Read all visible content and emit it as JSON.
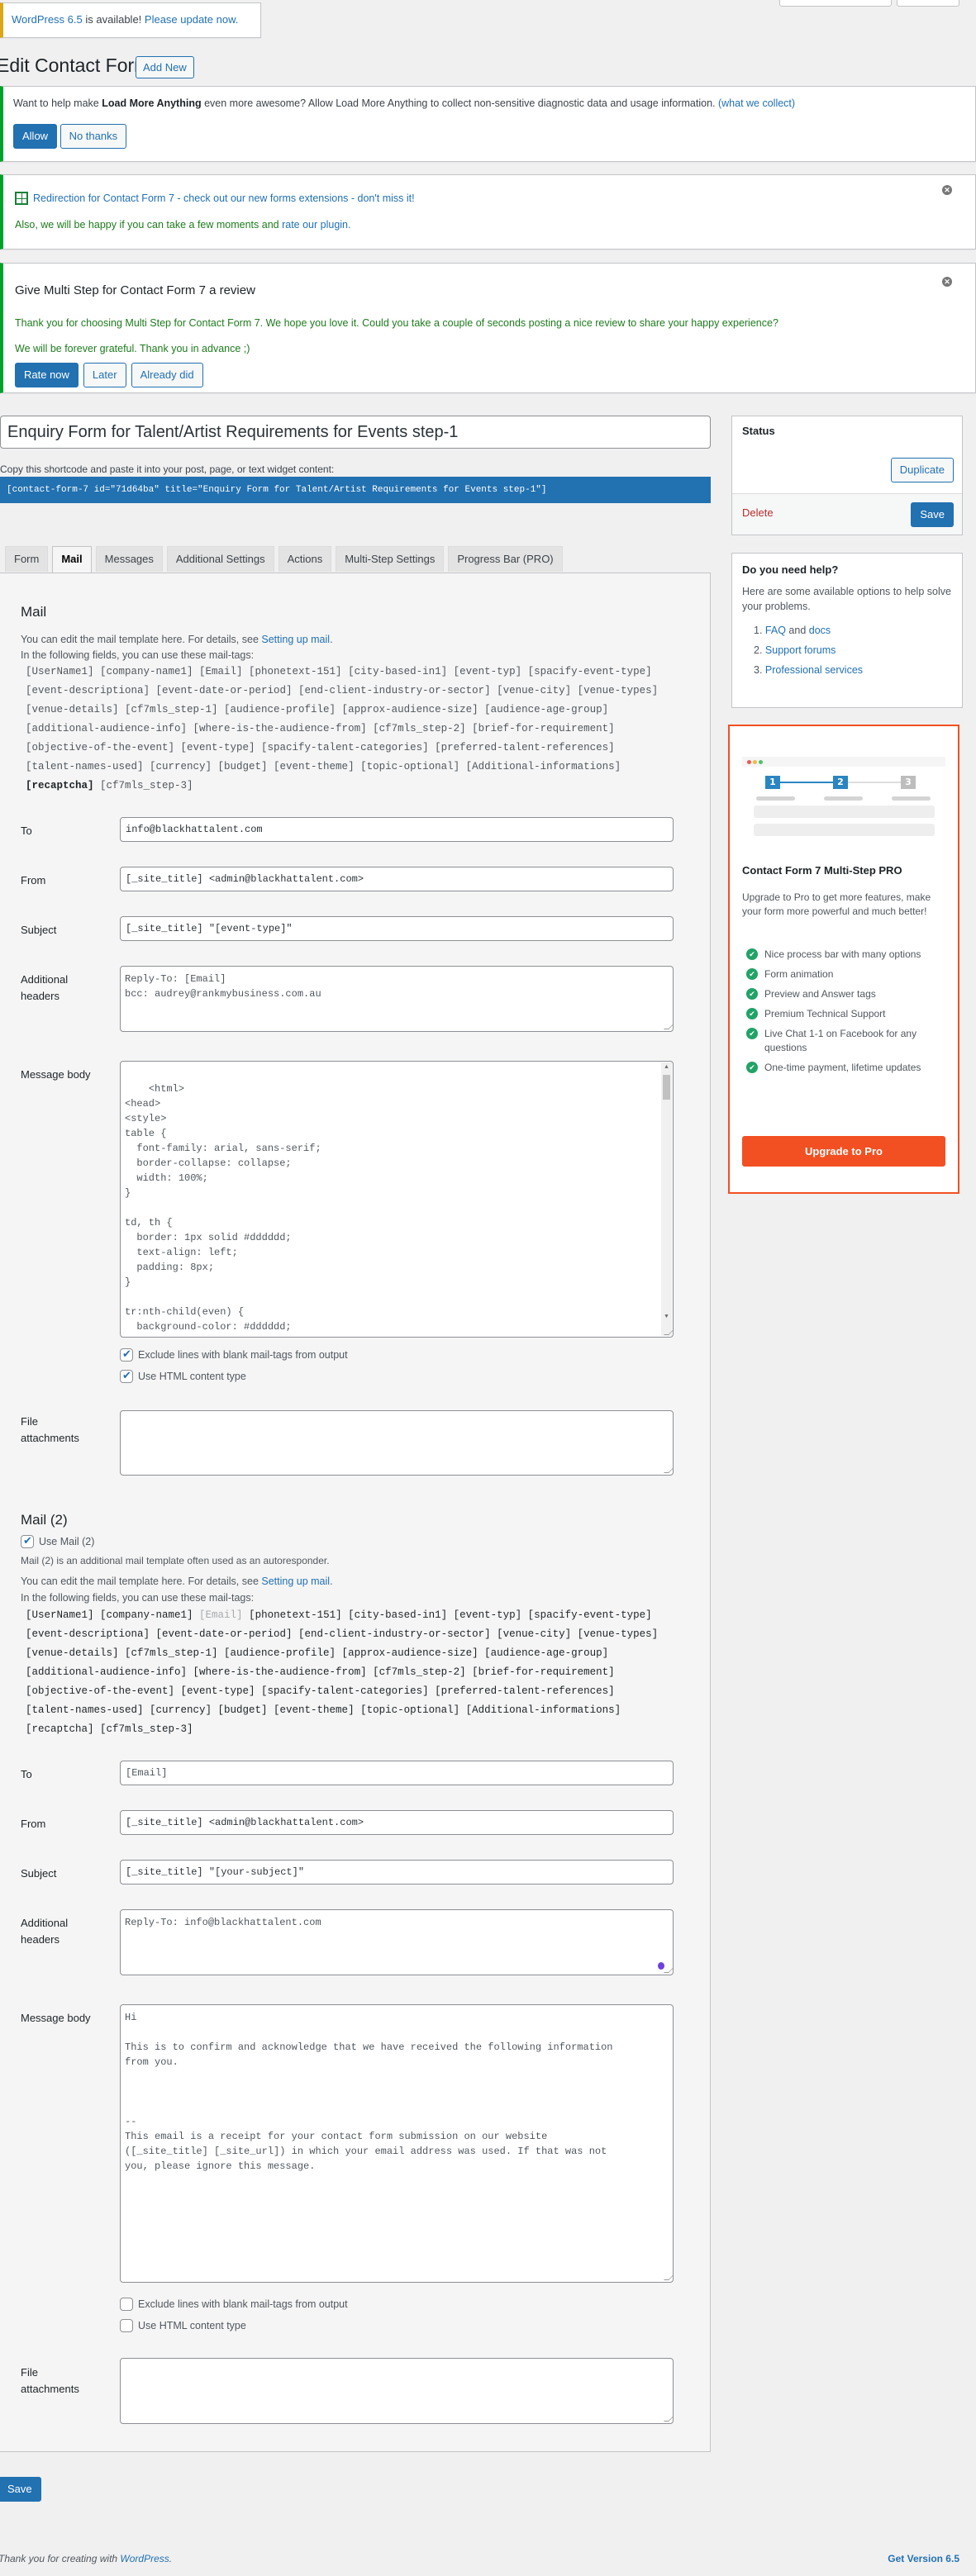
{
  "update_notice": {
    "prefix_link": "WordPress 6.5",
    "middle": " is available! ",
    "action_link": "Please update now."
  },
  "header": {
    "title": "Edit Contact Form",
    "add_new": "Add New"
  },
  "usage_notice": {
    "text_before": "Want to help make ",
    "plugin_name": "Load More Anything",
    "text_after": " even more awesome? Allow Load More Anything to collect non-sensitive diagnostic data and usage information. ",
    "link": "(what we collect)",
    "allow": "Allow",
    "no_thanks": "No thanks"
  },
  "redirect_notice": {
    "line1": "Redirection for Contact Form 7 - check out our new forms extensions - don't miss it!",
    "line2_before": "Also, we will be happy if you can take a few moments and ",
    "line2_link": "rate our plugin."
  },
  "review_notice": {
    "title": "Give Multi Step for Contact Form 7 a review",
    "p1": "Thank you for choosing Multi Step for Contact Form 7. We hope you love it. Could you take a couple of seconds posting a nice review to share your happy experience?",
    "p2": "We will be forever grateful. Thank you in advance ;)",
    "rate_now": "Rate now",
    "later": "Later",
    "already_did": "Already did"
  },
  "form_title": "Enquiry Form for Talent/Artist Requirements for Events step-1",
  "shortcode_hint": "Copy this shortcode and paste it into your post, page, or text widget content:",
  "shortcode": "[contact-form-7 id=\"71d64ba\" title=\"Enquiry Form for Talent/Artist Requirements for Events step-1\"]",
  "tabs": [
    {
      "label": "Form",
      "active": false
    },
    {
      "label": "Mail",
      "active": true
    },
    {
      "label": "Messages",
      "active": false
    },
    {
      "label": "Additional Settings",
      "active": false
    },
    {
      "label": "Actions",
      "active": false
    },
    {
      "label": "Multi-Step Settings",
      "active": false
    },
    {
      "label": "Progress Bar (PRO)",
      "active": false
    }
  ],
  "mail": {
    "title": "Mail",
    "desc_before": "You can edit the mail template here. For details, see ",
    "desc_link": "Setting up mail",
    "desc_after": ".",
    "tags_intro": "In the following fields, you can use these mail-tags:",
    "tag_lines": [
      "[UserName1] [company-name1] [Email] [phonetext-151] [city-based-in1] [event-typ] [spacify-event-type]",
      "[event-descriptiona] [event-date-or-period] [end-client-industry-or-sector] [venue-city] [venue-types]",
      "[venue-details] [cf7mls_step-1] [audience-profile] [approx-audience-size] [audience-age-group]",
      "[additional-audience-info] [where-is-the-audience-from] [cf7mls_step-2] [brief-for-requirement]",
      "[objective-of-the-event] [event-type] [spacify-talent-categories] [preferred-talent-references]",
      "[talent-names-used] [currency] [budget] [event-theme] [topic-optional] [Additional-informations]"
    ],
    "tag_last_strong": "[recaptcha]",
    "tag_last_rest": " [cf7mls_step-3]",
    "labels": {
      "to": "To",
      "from": "From",
      "subject": "Subject",
      "headers": "Additional headers",
      "body": "Message body",
      "attachments": "File attachments"
    },
    "to": "info@blackhattalent.com",
    "from": "[_site_title] <admin@blackhattalent.com>",
    "subject": "[_site_title] \"[event-type]\"",
    "headers": "Reply-To: [Email]\nbcc: audrey@rankmybusiness.com.au",
    "body": "<html>\n<head>\n<style>\ntable {\n  font-family: arial, sans-serif;\n  border-collapse: collapse;\n  width: 100%;\n}\n\ntd, th {\n  border: 1px solid #dddddd;\n  text-align: left;\n  padding: 8px;\n}\n\ntr:nth-child(even) {\n  background-color: #dddddd;\n}",
    "exclude_blank": {
      "label": "Exclude lines with blank mail-tags from output",
      "checked": true
    },
    "use_html": {
      "label": "Use HTML content type",
      "checked": true
    },
    "attachments": ""
  },
  "mail2": {
    "title": "Mail (2)",
    "use_label": "Use Mail (2)",
    "use_checked": true,
    "note": "Mail (2) is an additional mail template often used as an autoresponder.",
    "desc_before": "You can edit the mail template here. For details, see ",
    "desc_link": "Setting up mail",
    "desc_after": ".",
    "tags_intro": "In the following fields, you can use these mail-tags:",
    "tag_line1_a": "[UserName1] [company-name1] ",
    "tag_line1_muted": "[Email]",
    "tag_line1_b": " [phonetext-151] [city-based-in1] [event-typ] [spacify-event-type]",
    "tag_lines": [
      "[event-descriptiona] [event-date-or-period] [end-client-industry-or-sector] [venue-city] [venue-types]",
      "[venue-details] [cf7mls_step-1] [audience-profile] [approx-audience-size] [audience-age-group]",
      "[additional-audience-info] [where-is-the-audience-from] [cf7mls_step-2] [brief-for-requirement]",
      "[objective-of-the-event] [event-type] [spacify-talent-categories] [preferred-talent-references]",
      "[talent-names-used] [currency] [budget] [event-theme] [topic-optional] [Additional-informations]",
      "[recaptcha] [cf7mls_step-3]"
    ],
    "to": "[Email]",
    "from": "[_site_title] <admin@blackhattalent.com>",
    "subject": "[_site_title] \"[your-subject]\"",
    "headers": "Reply-To: info@blackhattalent.com",
    "body": "Hi\n\nThis is to confirm and acknowledge that we have received the following information\nfrom you.\n\n\n\n--\nThis email is a receipt for your contact form submission on our website\n([_site_title] [_site_url]) in which your email address was used. If that was not\nyou, please ignore this message.",
    "exclude_blank": {
      "label": "Exclude lines with blank mail-tags from output",
      "checked": false
    },
    "use_html": {
      "label": "Use HTML content type",
      "checked": false
    },
    "attachments": ""
  },
  "status_box": {
    "title": "Status",
    "duplicate": "Duplicate",
    "delete": "Delete",
    "save": "Save"
  },
  "help_box": {
    "title": "Do you need help?",
    "desc": "Here are some available options to help solve your problems.",
    "items": [
      {
        "num": "1.",
        "a": "FAQ",
        "mid": " and ",
        "b": "docs"
      },
      {
        "num": "2.",
        "a": "Support forums",
        "mid": "",
        "b": ""
      },
      {
        "num": "3.",
        "a": "Professional services",
        "mid": "",
        "b": ""
      }
    ]
  },
  "pro_box": {
    "steps": [
      "1",
      "2",
      "3"
    ],
    "title": "Contact Form 7 Multi-Step PRO",
    "desc": "Upgrade to Pro to get more features, make your form more powerful and much better!",
    "features": [
      "Nice process bar with many options",
      "Form animation",
      "Preview and Answer tags",
      "Premium Technical Support",
      "Live Chat 1-1 on Facebook for any questions",
      "One-time payment, lifetime updates"
    ],
    "button": "Upgrade to Pro",
    "accent": "#f25022"
  },
  "bottom_save": "Save",
  "footer": {
    "before": "Thank you for creating with ",
    "link": "WordPress",
    "after": ".",
    "version": "Get Version 6.5"
  }
}
